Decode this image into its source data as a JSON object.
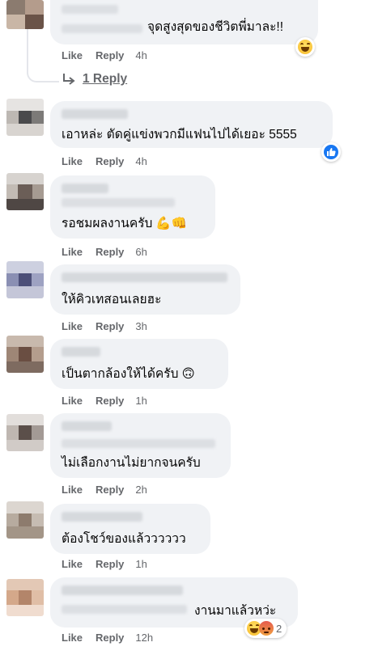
{
  "labels": {
    "like": "Like",
    "reply": "Reply"
  },
  "view_replies": "1 Reply",
  "comments": [
    {
      "text": "จุดสูงสุดของชีวิตพี่มาละ!!",
      "time": "4h",
      "reaction": "haha"
    },
    {
      "text": "เอาหล่ะ ตัดคู่แข่งพวกมีแฟนไปได้เยอะ 5555",
      "time": "4h",
      "reaction": "like"
    },
    {
      "text": "รอชมผลงานครับ",
      "emoji_text": "💪👊",
      "time": "6h"
    },
    {
      "text": "ให้คิวเทสอนเลยฮะ",
      "time": "3h"
    },
    {
      "text": "เป็นตากล้องให้ได้ครับ",
      "emoji_text": "🙃",
      "time": "1h"
    },
    {
      "text": "ไม่เลือกงานไม่ยากจนครับ",
      "time": "2h"
    },
    {
      "text": "ต้องโชว์ของแล้วววววว",
      "time": "1h"
    },
    {
      "text": "งานมาแล้วหว่ะ",
      "time": "12h",
      "reaction": "haha+angry",
      "reaction_count": "2"
    }
  ],
  "icons": {
    "reply_arrow": "reply-arrow-icon",
    "like": "like-icon",
    "haha": "haha-icon",
    "angry": "angry-icon",
    "avatar": "avatar"
  },
  "colors": {
    "bubble": "#f0f2f5",
    "meta": "#65676b",
    "text": "#050505",
    "like_blue": "#1877f2"
  }
}
